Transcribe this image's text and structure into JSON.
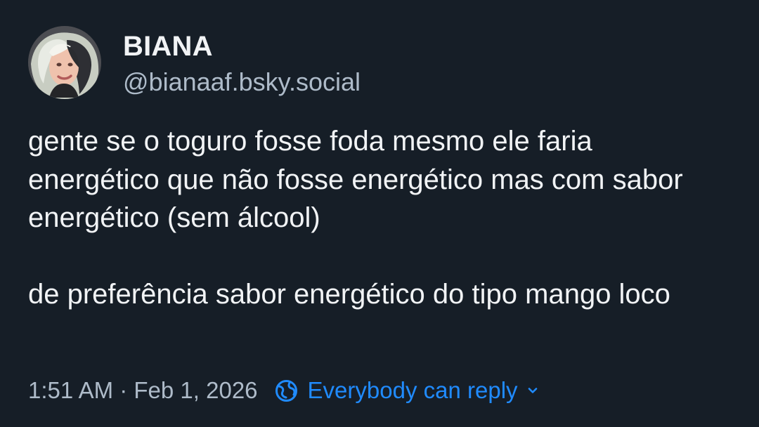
{
  "author": {
    "display_name": "BIANA",
    "handle": "@bianaaf.bsky.social",
    "avatar_icon": "user-avatar"
  },
  "post": {
    "paragraphs": [
      "gente se o toguro fosse foda mesmo ele faria energético que não fosse energético mas com sabor energético (sem álcool)",
      "de preferência sabor energético do tipo mango loco"
    ]
  },
  "meta": {
    "timestamp": "1:51 AM · Feb 1, 2026",
    "reply_setting_label": "Everybody can reply",
    "reply_icon": "globe-icon",
    "dropdown_icon": "chevron-down-icon"
  },
  "colors": {
    "background": "#161e27",
    "text_primary": "#f1f3f5",
    "text_secondary": "#aebbc9",
    "accent": "#208bfe"
  }
}
